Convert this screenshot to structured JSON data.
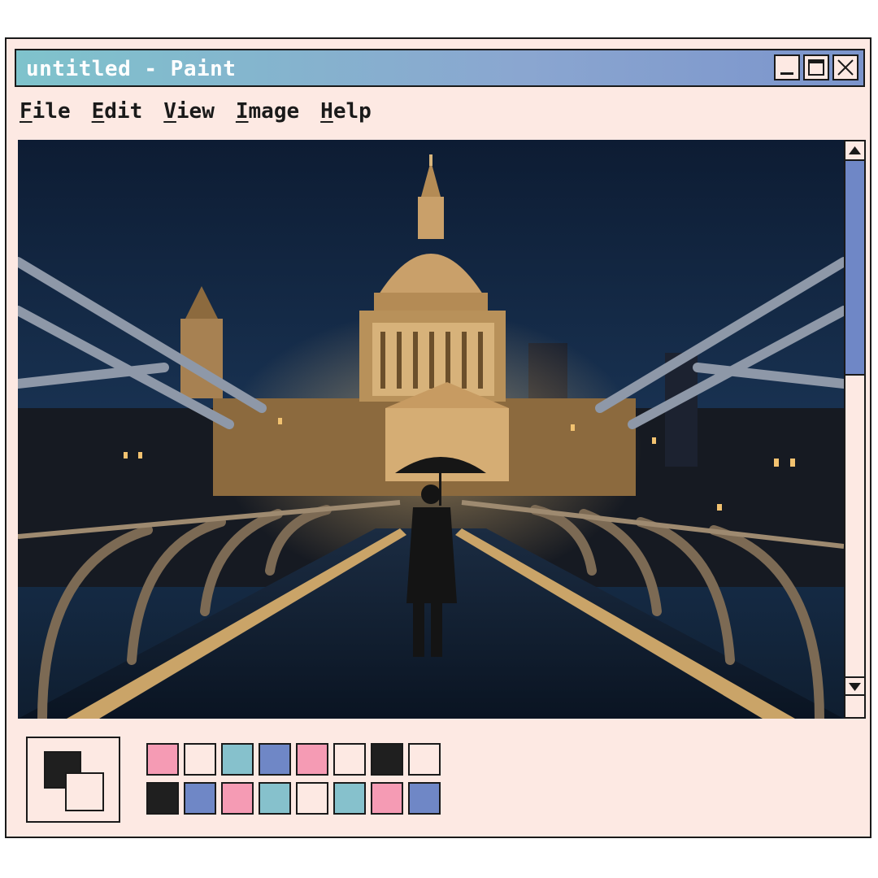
{
  "window": {
    "title": "untitled - Paint",
    "controls": [
      "minimize-icon",
      "maximize-icon",
      "close-icon"
    ]
  },
  "menu": [
    {
      "accel": "F",
      "rest": "ile"
    },
    {
      "accel": "E",
      "rest": "dit"
    },
    {
      "accel": "V",
      "rest": "iew"
    },
    {
      "accel": "I",
      "rest": "mage"
    },
    {
      "accel": "H",
      "rest": "elp"
    }
  ],
  "canvas": {
    "description_icon": "photo-canvas"
  },
  "colors": {
    "foreground": "#1f1f1f",
    "background": "#fde9e3",
    "palette_row1": [
      "#f59bb4",
      "#fde9e3",
      "#86c1cc",
      "#6f87c6",
      "#f59bb4",
      "#fde9e3",
      "#1f1f1f",
      "#fde9e3"
    ],
    "palette_row2": [
      "#1f1f1f",
      "#6f87c6",
      "#f59bb4",
      "#86c1cc",
      "#fde9e3",
      "#86c1cc",
      "#f59bb4",
      "#6f87c6"
    ]
  }
}
